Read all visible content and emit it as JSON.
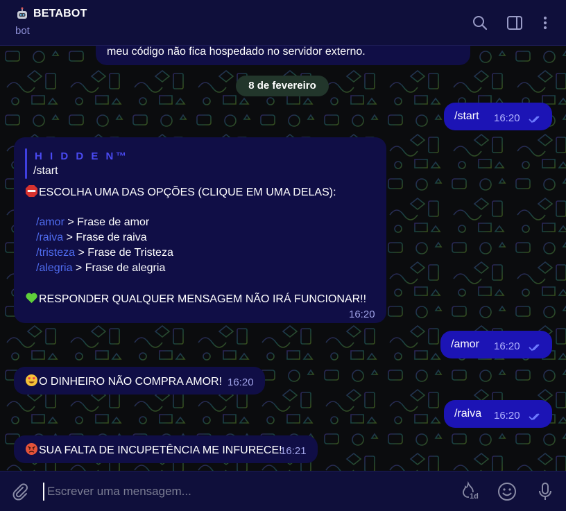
{
  "header": {
    "bot_emoji": "🤖",
    "title": "BETABOT",
    "subtitle": "bot",
    "icons": [
      "search-icon",
      "sidebar-toggle-icon",
      "more-vertical-icon"
    ]
  },
  "chat": {
    "partial_message": "meu código não fica hospedado no servidor externo.",
    "date_separator": "8 de fevereiro",
    "messages": [
      {
        "direction": "out",
        "text": "/start",
        "time": "16:20"
      },
      {
        "direction": "in",
        "reply_name": "H I D D E N™",
        "reply_text": "/start",
        "header_line": "ESCOLHA UMA DAS OPÇÕES (CLIQUE EM UMA DELAS):",
        "options": [
          {
            "command": "/amor",
            "label": " > Frase de amor"
          },
          {
            "command": "/raiva",
            "label": " > Frase de raiva"
          },
          {
            "command": "/tristeza",
            "label": " > Frase de Tristeza"
          },
          {
            "command": "/alegria",
            "label": " > Frase de alegria"
          }
        ],
        "footer_line": "RESPONDER QUALQUER MENSAGEM NÃO IRÁ FUNCIONAR!!",
        "time": "16:20"
      },
      {
        "direction": "out",
        "text": "/amor",
        "time": "16:20"
      },
      {
        "direction": "in",
        "text": "O DINHEIRO NÃO COMPRA AMOR!",
        "time": "16:20"
      },
      {
        "direction": "out",
        "text": "/raiva",
        "time": "16:20"
      },
      {
        "direction": "in",
        "text": "SUA FALTA DE INCUPETÊNCIA ME INFURECE!",
        "time": "16:21"
      }
    ]
  },
  "composer": {
    "placeholder": "Escrever uma mensagem...",
    "timer_badge": "1d",
    "icons": [
      "attach-icon",
      "self-destruct-timer-icon",
      "emoji-icon",
      "microphone-icon"
    ]
  },
  "colors": {
    "header_bg": "#0f0f3b",
    "incoming_bubble": "#100e46",
    "outgoing_bubble": "#1c14b5",
    "command_link": "#4f6cf0",
    "date_pill": "#22362b"
  }
}
